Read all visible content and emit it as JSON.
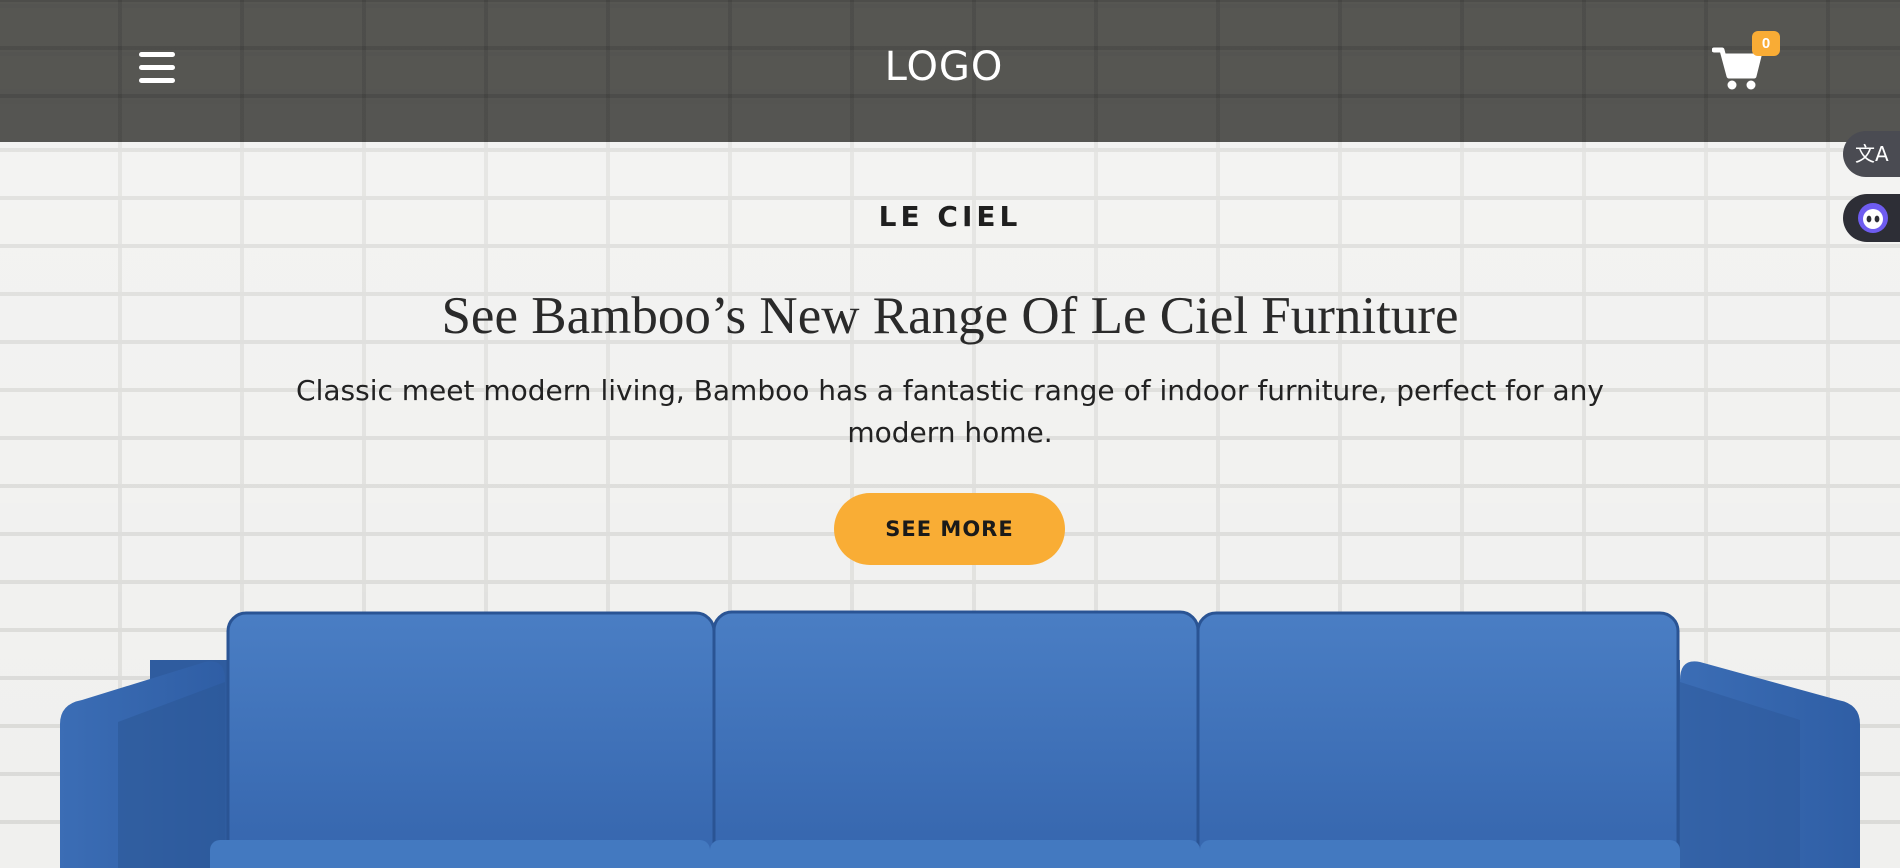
{
  "header": {
    "logo_text": "LOGO",
    "cart_count": "0"
  },
  "side_widgets": {
    "translate_glyph": "文A"
  },
  "hero": {
    "eyebrow": "LE CIEL",
    "headline": "See Bamboo’s New Range Of Le Ciel Furniture",
    "description": "Classic meet modern living, Bamboo has a fantastic range of indoor furniture, perfect for any modern home.",
    "cta_label": "SEE MORE"
  },
  "colors": {
    "header_bg": "#4a4a46",
    "accent": "#f9ad35",
    "sofa_blue": "#3b6db5",
    "wall": "#eeeeec"
  },
  "icons": [
    "menu-icon",
    "cart-icon",
    "translate-icon",
    "chatbot-icon"
  ]
}
